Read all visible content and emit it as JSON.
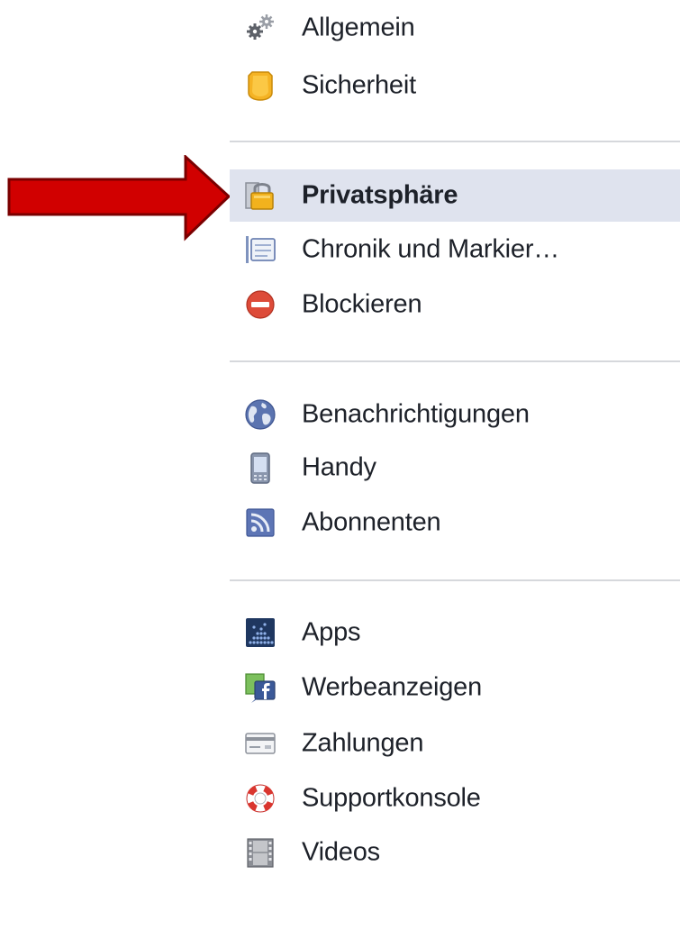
{
  "settings_menu": {
    "groups": [
      {
        "items": [
          {
            "label": "Allgemein",
            "icon": "gears-icon"
          },
          {
            "label": "Sicherheit",
            "icon": "badge-icon"
          }
        ]
      },
      {
        "items": [
          {
            "label": "Privatsphäre",
            "icon": "lock-icon",
            "selected": true
          },
          {
            "label": "Chronik und Markier…",
            "icon": "timeline-icon"
          },
          {
            "label": "Blockieren",
            "icon": "block-icon"
          }
        ]
      },
      {
        "items": [
          {
            "label": "Benachrichtigungen",
            "icon": "globe-icon"
          },
          {
            "label": "Handy",
            "icon": "phone-icon"
          },
          {
            "label": "Abonnenten",
            "icon": "rss-icon"
          }
        ]
      },
      {
        "items": [
          {
            "label": "Apps",
            "icon": "apps-icon"
          },
          {
            "label": "Werbeanzeigen",
            "icon": "ads-icon"
          },
          {
            "label": "Zahlungen",
            "icon": "credit-card-icon"
          },
          {
            "label": "Supportkonsole",
            "icon": "lifebuoy-icon"
          },
          {
            "label": "Videos",
            "icon": "film-icon"
          }
        ]
      }
    ]
  },
  "annotation": {
    "icon": "red-arrow-icon",
    "color": "#cc0000"
  },
  "colors": {
    "selected_bg": "#dfe3ee",
    "divider": "#d6d8dc",
    "text": "#1d2129"
  }
}
